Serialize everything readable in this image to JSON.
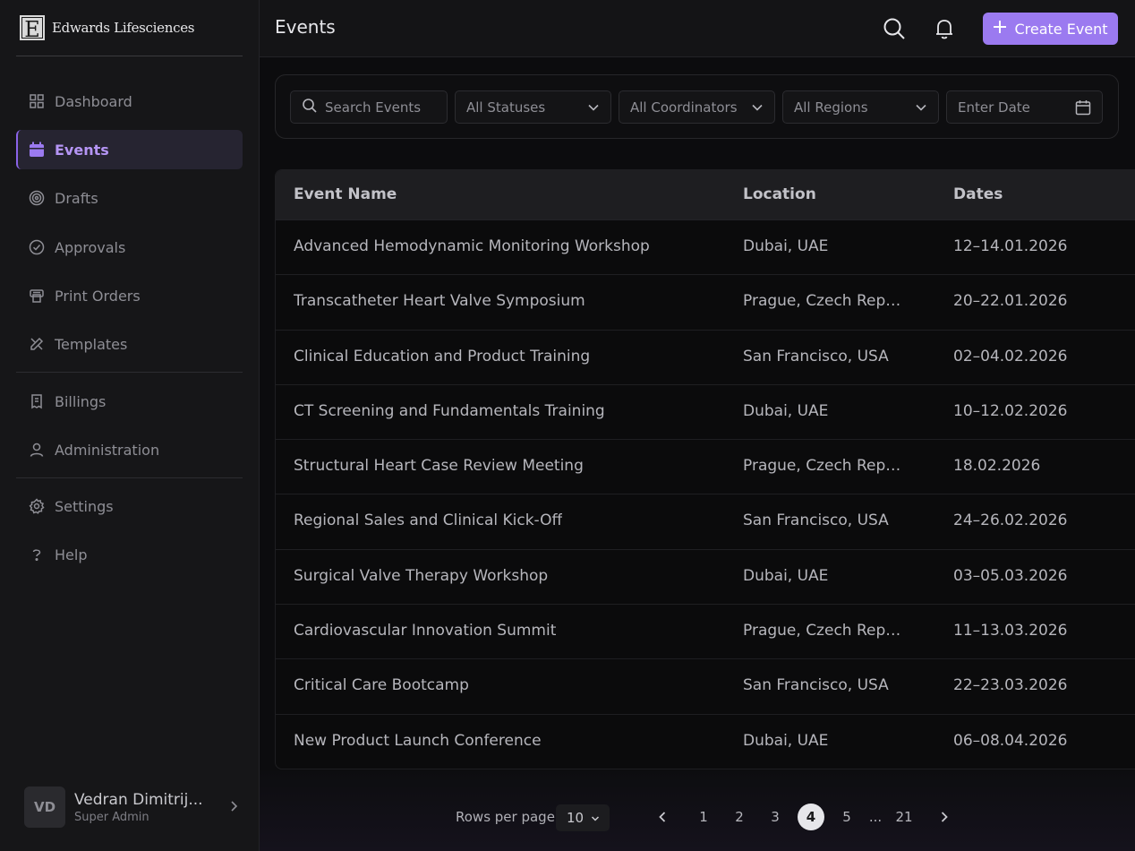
{
  "brand": {
    "logo_letter": "E",
    "name": "Edwards Lifesciences"
  },
  "sidebar": {
    "items": [
      {
        "label": "Dashboard",
        "icon": "grid-icon"
      },
      {
        "label": "Events",
        "icon": "calendar-icon",
        "active": true
      },
      {
        "label": "Drafts",
        "icon": "target-icon"
      },
      {
        "label": "Approvals",
        "icon": "check-circle-icon"
      },
      {
        "label": "Print Orders",
        "icon": "printer-icon"
      },
      {
        "label": "Templates",
        "icon": "pencil-ruler-icon"
      },
      {
        "label": "Billings",
        "icon": "receipt-icon"
      },
      {
        "label": "Administration",
        "icon": "user-icon"
      },
      {
        "label": "Settings",
        "icon": "gear-icon"
      },
      {
        "label": "Help",
        "icon": "help-icon"
      }
    ]
  },
  "user": {
    "initials": "VD",
    "name": "Vedran Dimitrij...",
    "role": "Super Admin"
  },
  "header": {
    "title": "Events",
    "create_label": "Create Event"
  },
  "filters": {
    "search_placeholder": "Search Events",
    "status": "All Statuses",
    "coordinator": "All Coordinators",
    "region": "All Regions",
    "date_placeholder": "Enter Date"
  },
  "table": {
    "columns": [
      "Event Name",
      "Location",
      "Dates"
    ],
    "rows": [
      [
        "Advanced Hemodynamic Monitoring Workshop",
        "Dubai, UAE",
        "12–14.01.2026"
      ],
      [
        "Transcatheter Heart Valve Symposium",
        "Prague, Czech Rep…",
        "20–22.01.2026"
      ],
      [
        "Clinical Education and Product Training",
        "San Francisco, USA",
        "02–04.02.2026"
      ],
      [
        "CT Screening and Fundamentals Training",
        "Dubai, UAE",
        "10–12.02.2026"
      ],
      [
        "Structural Heart Case Review Meeting",
        "Prague, Czech Rep…",
        "18.02.2026"
      ],
      [
        "Regional Sales and Clinical Kick-Off",
        "San Francisco, USA",
        "24–26.02.2026"
      ],
      [
        "Surgical Valve Therapy Workshop",
        "Dubai, UAE",
        "03–05.03.2026"
      ],
      [
        "Cardiovascular Innovation Summit",
        "Prague, Czech Rep…",
        "11–13.03.2026"
      ],
      [
        "Critical Care Bootcamp",
        "San Francisco, USA",
        "22–23.03.2026"
      ],
      [
        "New Product Launch Conference",
        "Dubai, UAE",
        "06–08.04.2026"
      ]
    ]
  },
  "pagination": {
    "rows_label": "Rows per page",
    "rows_value": "10",
    "pages": [
      "1",
      "2",
      "3",
      "4",
      "5",
      "...",
      "21"
    ],
    "current": "4"
  },
  "colors": {
    "accent": "#9b7af0",
    "active_nav": "#b595f5"
  }
}
